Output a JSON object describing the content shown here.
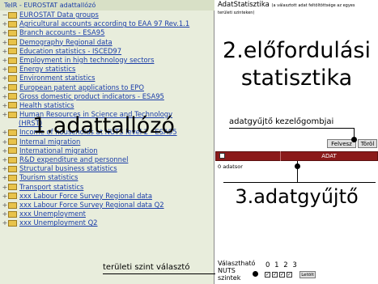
{
  "left_panel": {
    "title": "TeIR - EUROSTAT adattallózó",
    "tree": [
      {
        "label": "EUROSTAT Data groups",
        "root": true
      },
      {
        "label": "Agricultural accounts according to EAA 97 Rev.1.1"
      },
      {
        "label": "Branch accounts - ESA95"
      },
      {
        "label": "Demography Regional data"
      },
      {
        "label": "Education statistics - ISCED97"
      },
      {
        "label": "Employment in high technology sectors"
      },
      {
        "label": "Energy statistics"
      },
      {
        "label": "Environment statistics"
      },
      {
        "label": "European patent applications to EPO"
      },
      {
        "label": "Gross domestic product indicators - ESA95"
      },
      {
        "label": "Health statistics"
      },
      {
        "label": "Human Resources in Science and Technology"
      },
      {
        "label": "(HRST)"
      },
      {
        "label": "Income of households at NUTS level 2 - ESA95"
      },
      {
        "label": "Internal migration"
      },
      {
        "label": "International migration"
      },
      {
        "label": "R&D expenditure and personnel"
      },
      {
        "label": "Structural business statistics"
      },
      {
        "label": "Tourism statistics"
      },
      {
        "label": "Transport statistics"
      },
      {
        "label": "xxx Labour Force Survey Regional data"
      },
      {
        "label": "xxx Labour Force Survey Regional data Q2"
      },
      {
        "label": "xxx Unemployment"
      },
      {
        "label": "xxx Unemployment Q2"
      }
    ],
    "annotation_1": "1.adattallózó",
    "annotation_level": "területi szint választó"
  },
  "right_panel": {
    "title": "AdatStatisztika",
    "title_note": "(a választott adat feltöltöttsége az egyes",
    "subtitle_note": "területi szinteken)",
    "annotation_2": "2.előfordulási statisztika",
    "annotation_buttons": "adatgyűjtő kezelőgombjai",
    "add_button": "Felvesz",
    "delete_button": "Töröl",
    "collector_column_header": "ADAT",
    "collector_count": "0 adatsor",
    "annotation_3": "3.adatgyűjtő",
    "level_caption_lines": [
      "Választható",
      "NUTS",
      "szintek"
    ],
    "level_numbers": "0 1 2 3",
    "download_button": "Letölt"
  },
  "colors": {
    "left_bg": "#e8eddc",
    "link": "#1a3da8",
    "collector_header": "#8b1a1a",
    "folder": "#e8c34a"
  }
}
